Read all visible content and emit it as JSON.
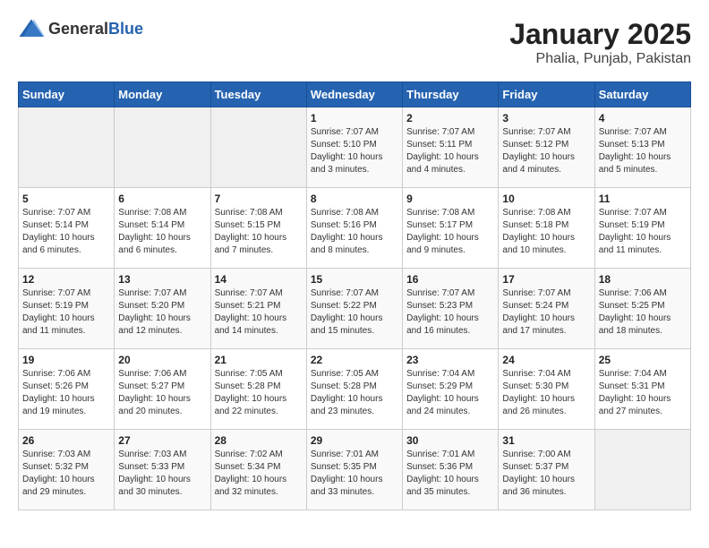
{
  "header": {
    "logo_general": "General",
    "logo_blue": "Blue",
    "title": "January 2025",
    "subtitle": "Phalia, Punjab, Pakistan"
  },
  "weekdays": [
    "Sunday",
    "Monday",
    "Tuesday",
    "Wednesday",
    "Thursday",
    "Friday",
    "Saturday"
  ],
  "weeks": [
    [
      {
        "day": "",
        "info": ""
      },
      {
        "day": "",
        "info": ""
      },
      {
        "day": "",
        "info": ""
      },
      {
        "day": "1",
        "info": "Sunrise: 7:07 AM\nSunset: 5:10 PM\nDaylight: 10 hours and 3 minutes."
      },
      {
        "day": "2",
        "info": "Sunrise: 7:07 AM\nSunset: 5:11 PM\nDaylight: 10 hours and 4 minutes."
      },
      {
        "day": "3",
        "info": "Sunrise: 7:07 AM\nSunset: 5:12 PM\nDaylight: 10 hours and 4 minutes."
      },
      {
        "day": "4",
        "info": "Sunrise: 7:07 AM\nSunset: 5:13 PM\nDaylight: 10 hours and 5 minutes."
      }
    ],
    [
      {
        "day": "5",
        "info": "Sunrise: 7:07 AM\nSunset: 5:14 PM\nDaylight: 10 hours and 6 minutes."
      },
      {
        "day": "6",
        "info": "Sunrise: 7:08 AM\nSunset: 5:14 PM\nDaylight: 10 hours and 6 minutes."
      },
      {
        "day": "7",
        "info": "Sunrise: 7:08 AM\nSunset: 5:15 PM\nDaylight: 10 hours and 7 minutes."
      },
      {
        "day": "8",
        "info": "Sunrise: 7:08 AM\nSunset: 5:16 PM\nDaylight: 10 hours and 8 minutes."
      },
      {
        "day": "9",
        "info": "Sunrise: 7:08 AM\nSunset: 5:17 PM\nDaylight: 10 hours and 9 minutes."
      },
      {
        "day": "10",
        "info": "Sunrise: 7:08 AM\nSunset: 5:18 PM\nDaylight: 10 hours and 10 minutes."
      },
      {
        "day": "11",
        "info": "Sunrise: 7:07 AM\nSunset: 5:19 PM\nDaylight: 10 hours and 11 minutes."
      }
    ],
    [
      {
        "day": "12",
        "info": "Sunrise: 7:07 AM\nSunset: 5:19 PM\nDaylight: 10 hours and 11 minutes."
      },
      {
        "day": "13",
        "info": "Sunrise: 7:07 AM\nSunset: 5:20 PM\nDaylight: 10 hours and 12 minutes."
      },
      {
        "day": "14",
        "info": "Sunrise: 7:07 AM\nSunset: 5:21 PM\nDaylight: 10 hours and 14 minutes."
      },
      {
        "day": "15",
        "info": "Sunrise: 7:07 AM\nSunset: 5:22 PM\nDaylight: 10 hours and 15 minutes."
      },
      {
        "day": "16",
        "info": "Sunrise: 7:07 AM\nSunset: 5:23 PM\nDaylight: 10 hours and 16 minutes."
      },
      {
        "day": "17",
        "info": "Sunrise: 7:07 AM\nSunset: 5:24 PM\nDaylight: 10 hours and 17 minutes."
      },
      {
        "day": "18",
        "info": "Sunrise: 7:06 AM\nSunset: 5:25 PM\nDaylight: 10 hours and 18 minutes."
      }
    ],
    [
      {
        "day": "19",
        "info": "Sunrise: 7:06 AM\nSunset: 5:26 PM\nDaylight: 10 hours and 19 minutes."
      },
      {
        "day": "20",
        "info": "Sunrise: 7:06 AM\nSunset: 5:27 PM\nDaylight: 10 hours and 20 minutes."
      },
      {
        "day": "21",
        "info": "Sunrise: 7:05 AM\nSunset: 5:28 PM\nDaylight: 10 hours and 22 minutes."
      },
      {
        "day": "22",
        "info": "Sunrise: 7:05 AM\nSunset: 5:28 PM\nDaylight: 10 hours and 23 minutes."
      },
      {
        "day": "23",
        "info": "Sunrise: 7:04 AM\nSunset: 5:29 PM\nDaylight: 10 hours and 24 minutes."
      },
      {
        "day": "24",
        "info": "Sunrise: 7:04 AM\nSunset: 5:30 PM\nDaylight: 10 hours and 26 minutes."
      },
      {
        "day": "25",
        "info": "Sunrise: 7:04 AM\nSunset: 5:31 PM\nDaylight: 10 hours and 27 minutes."
      }
    ],
    [
      {
        "day": "26",
        "info": "Sunrise: 7:03 AM\nSunset: 5:32 PM\nDaylight: 10 hours and 29 minutes."
      },
      {
        "day": "27",
        "info": "Sunrise: 7:03 AM\nSunset: 5:33 PM\nDaylight: 10 hours and 30 minutes."
      },
      {
        "day": "28",
        "info": "Sunrise: 7:02 AM\nSunset: 5:34 PM\nDaylight: 10 hours and 32 minutes."
      },
      {
        "day": "29",
        "info": "Sunrise: 7:01 AM\nSunset: 5:35 PM\nDaylight: 10 hours and 33 minutes."
      },
      {
        "day": "30",
        "info": "Sunrise: 7:01 AM\nSunset: 5:36 PM\nDaylight: 10 hours and 35 minutes."
      },
      {
        "day": "31",
        "info": "Sunrise: 7:00 AM\nSunset: 5:37 PM\nDaylight: 10 hours and 36 minutes."
      },
      {
        "day": "",
        "info": ""
      }
    ]
  ]
}
